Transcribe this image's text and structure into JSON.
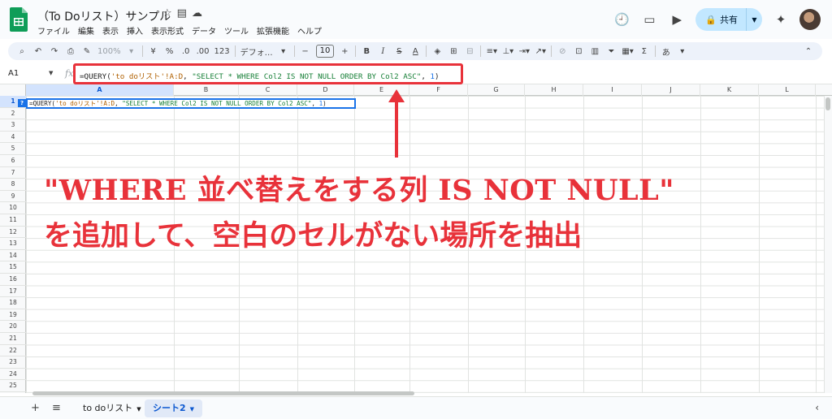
{
  "app": {
    "title": "（To Doリスト）サンプル",
    "menu": [
      "ファイル",
      "編集",
      "表示",
      "挿入",
      "表示形式",
      "データ",
      "ツール",
      "拡張機能",
      "ヘルプ"
    ],
    "share_label": "共有",
    "title_icons": [
      "☆",
      "▤",
      "☁"
    ]
  },
  "toolbar": {
    "zoom": "100%",
    "currency": "¥",
    "percent": "%",
    "dec_less": ".0",
    "dec_more": ".00",
    "number_format": "123",
    "font": "デフォ…",
    "font_size": "10",
    "minus": "−",
    "plus": "+",
    "bold": "B",
    "italic": "I",
    "strike": "S",
    "text_color": "A",
    "input_tools": "あ",
    "sum": "Σ"
  },
  "formula_bar": {
    "cell_ref": "A1",
    "fx": "fx",
    "formula_prefix": "=QUERY(",
    "formula_str1": "'to doリスト'!A:D",
    "formula_sep1": ", ",
    "formula_str2": "\"SELECT * WHERE Col2 IS NOT NULL ORDER BY Col2 ASC\"",
    "formula_sep2": ", ",
    "formula_num": "1",
    "formula_suffix": ")"
  },
  "grid": {
    "columns": [
      "A",
      "B",
      "C",
      "D",
      "E",
      "F",
      "G",
      "H",
      "I",
      "J",
      "K",
      "L"
    ],
    "selected_column": "A",
    "rows": [
      "1",
      "2",
      "3",
      "4",
      "5",
      "6",
      "7",
      "8",
      "9",
      "10",
      "11",
      "12",
      "13",
      "14",
      "15",
      "16",
      "17",
      "18",
      "19",
      "20",
      "21",
      "22",
      "23",
      "24",
      "25"
    ],
    "selected_row": "1",
    "cell_a1_hint": "?"
  },
  "annotation": {
    "line1": "\"WHERE 並べ替えをする列 IS NOT NULL\"",
    "line2": "を追加して、空白のセルがない場所を抽出",
    "color": "#e8323a"
  },
  "sheets": {
    "add": "+",
    "list": "≡",
    "tabs": [
      {
        "name": "to doリスト",
        "active": false
      },
      {
        "name": "シート2",
        "active": true
      }
    ],
    "collapse": "‹"
  },
  "colors": {
    "accent": "#1a73e8",
    "share_bg": "#c2e7ff",
    "highlight": "#e8323a"
  }
}
